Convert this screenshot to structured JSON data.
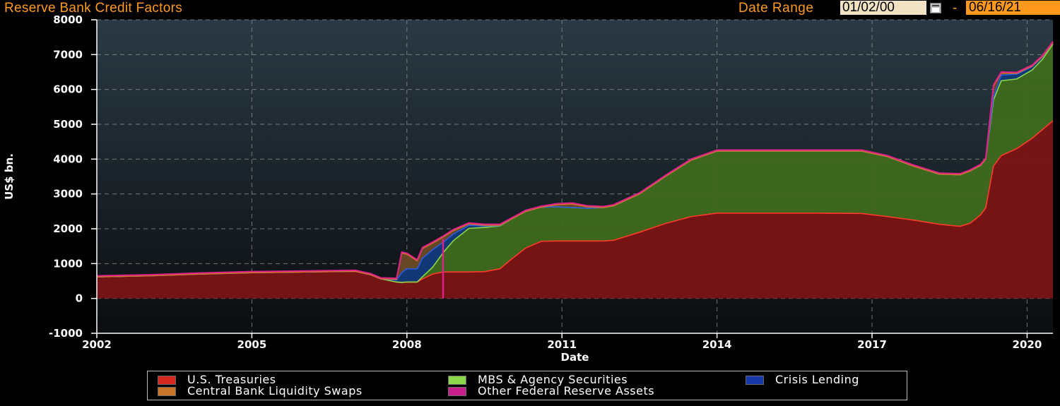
{
  "header": {
    "title": "Reserve Bank Credit Factors",
    "date_range_label": "Date Range",
    "start_date": "01/02/00",
    "separator": "-",
    "end_date": "06/16/21"
  },
  "colors": {
    "background": "#000000",
    "plot_top": "#2a3a44",
    "plot_bottom": "#0b0d10",
    "treasuries_fill": "#7a1414",
    "treasuries_line": "#ff3a2a",
    "mbs_fill": "#3f6a1e",
    "mbs_line": "#8cd84a",
    "crisis_fill": "#123a7a",
    "crisis_line": "#2a5ae0",
    "swaps_fill": "#6a4a26",
    "swaps_line": "#d27a26",
    "other_line": "#e0208a",
    "orange_accent": "#ff9a1f"
  },
  "chart_data": {
    "type": "area",
    "stacked": true,
    "title": "Reserve Bank Credit Factors",
    "xlabel": "Date",
    "ylabel": "US$ bn.",
    "xlim": [
      2002.0,
      2020.5
    ],
    "ylim": [
      -1000,
      8000
    ],
    "x_ticks": [
      2002,
      2005,
      2008,
      2011,
      2014,
      2017,
      2020
    ],
    "y_ticks": [
      -1000,
      0,
      1000,
      2000,
      3000,
      4000,
      5000,
      6000,
      7000,
      8000
    ],
    "grid": true,
    "legend_position": "bottom",
    "x": [
      2002.0,
      2003.0,
      2004.0,
      2005.0,
      2006.0,
      2007.0,
      2007.3,
      2007.5,
      2007.8,
      2007.9,
      2008.0,
      2008.2,
      2008.3,
      2008.5,
      2008.7,
      2008.9,
      2009.2,
      2009.5,
      2009.8,
      2010.0,
      2010.3,
      2010.6,
      2010.9,
      2011.2,
      2011.5,
      2011.8,
      2012.0,
      2012.5,
      2013.0,
      2013.5,
      2014.0,
      2015.0,
      2016.0,
      2016.8,
      2017.3,
      2017.8,
      2018.3,
      2018.7,
      2018.9,
      2019.1,
      2019.2,
      2019.35,
      2019.5,
      2019.8,
      2020.1,
      2020.3,
      2020.5
    ],
    "series": [
      {
        "name": "U.S. Treasuries",
        "values": [
          620,
          650,
          700,
          740,
          760,
          780,
          680,
          560,
          470,
          460,
          470,
          470,
          560,
          700,
          760,
          760,
          760,
          770,
          850,
          1100,
          1450,
          1640,
          1650,
          1650,
          1650,
          1650,
          1670,
          1900,
          2150,
          2350,
          2450,
          2450,
          2450,
          2440,
          2350,
          2250,
          2130,
          2070,
          2160,
          2400,
          2600,
          3800,
          4100,
          4300,
          4600,
          4850,
          5100
        ]
      },
      {
        "name": "MBS & Agency Securities",
        "values": [
          0,
          0,
          0,
          0,
          0,
          0,
          0,
          0,
          0,
          0,
          0,
          0,
          60,
          200,
          550,
          900,
          1250,
          1270,
          1230,
          1160,
          1050,
          980,
          980,
          960,
          940,
          960,
          990,
          1100,
          1350,
          1620,
          1780,
          1780,
          1780,
          1790,
          1720,
          1550,
          1440,
          1480,
          1500,
          1420,
          1400,
          1900,
          2150,
          2000,
          1960,
          2020,
          2200
        ]
      },
      {
        "name": "Crisis Lending",
        "values": [
          0,
          0,
          0,
          0,
          0,
          0,
          0,
          0,
          60,
          280,
          380,
          380,
          530,
          500,
          300,
          190,
          90,
          40,
          10,
          0,
          0,
          0,
          0,
          0,
          0,
          0,
          0,
          0,
          0,
          0,
          0,
          0,
          0,
          0,
          0,
          0,
          0,
          0,
          0,
          0,
          0,
          100,
          160,
          140,
          100,
          70,
          40
        ]
      },
      {
        "name": "Central Bank Liquidity Swaps",
        "values": [
          0,
          0,
          0,
          0,
          0,
          0,
          0,
          0,
          20,
          560,
          420,
          230,
          280,
          190,
          150,
          100,
          40,
          20,
          10,
          0,
          0,
          0,
          60,
          100,
          40,
          0,
          0,
          0,
          0,
          0,
          0,
          0,
          0,
          0,
          0,
          0,
          0,
          0,
          0,
          0,
          0,
          300,
          60,
          20,
          10,
          10,
          5
        ]
      },
      {
        "name": "Other Federal Reserve Assets",
        "values": [
          30,
          30,
          30,
          30,
          30,
          30,
          30,
          30,
          30,
          30,
          30,
          30,
          30,
          30,
          30,
          30,
          30,
          30,
          30,
          30,
          30,
          30,
          30,
          30,
          30,
          30,
          30,
          30,
          30,
          30,
          30,
          30,
          30,
          30,
          30,
          30,
          30,
          30,
          30,
          30,
          30,
          30,
          30,
          30,
          30,
          30,
          30
        ]
      }
    ],
    "annotation_spike": {
      "series": "Other Federal Reserve Assets",
      "x": 2008.7,
      "y_from": 0,
      "y_to": 1700
    }
  },
  "legend": {
    "items": [
      {
        "label": "U.S. Treasuries",
        "color": "#d4281e"
      },
      {
        "label": "MBS & Agency Securities",
        "color": "#8cd84a"
      },
      {
        "label": "Crisis Lending",
        "color": "#1638a8"
      },
      {
        "label": "Central Bank Liquidity Swaps",
        "color": "#c8742a"
      },
      {
        "label": "Other Federal Reserve Assets",
        "color": "#c8208a"
      }
    ]
  }
}
